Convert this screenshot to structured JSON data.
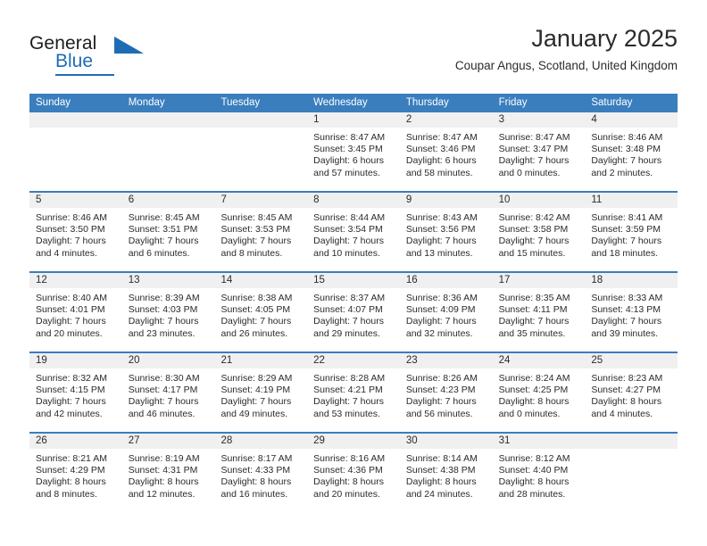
{
  "logo": {
    "general_text": "General",
    "blue_text": "Blue",
    "triangle_color": "#1f6cb4",
    "blue_color": "#1f6cb4",
    "general_color": "#1d1d1d"
  },
  "header": {
    "month_title": "January 2025",
    "location": "Coupar Angus, Scotland, United Kingdom"
  },
  "theme": {
    "header_band": "#3a7ebe",
    "day_band": "#f0f0f0",
    "text": "#2b2b2b"
  },
  "weekdays": [
    "Sunday",
    "Monday",
    "Tuesday",
    "Wednesday",
    "Thursday",
    "Friday",
    "Saturday"
  ],
  "weeks": [
    [
      {
        "day": "",
        "empty": true,
        "lines": []
      },
      {
        "day": "",
        "empty": true,
        "lines": []
      },
      {
        "day": "",
        "empty": true,
        "lines": []
      },
      {
        "day": "1",
        "lines": [
          "Sunrise: 8:47 AM",
          "Sunset: 3:45 PM",
          "Daylight: 6 hours",
          "and 57 minutes."
        ]
      },
      {
        "day": "2",
        "lines": [
          "Sunrise: 8:47 AM",
          "Sunset: 3:46 PM",
          "Daylight: 6 hours",
          "and 58 minutes."
        ]
      },
      {
        "day": "3",
        "lines": [
          "Sunrise: 8:47 AM",
          "Sunset: 3:47 PM",
          "Daylight: 7 hours",
          "and 0 minutes."
        ]
      },
      {
        "day": "4",
        "lines": [
          "Sunrise: 8:46 AM",
          "Sunset: 3:48 PM",
          "Daylight: 7 hours",
          "and 2 minutes."
        ]
      }
    ],
    [
      {
        "day": "5",
        "lines": [
          "Sunrise: 8:46 AM",
          "Sunset: 3:50 PM",
          "Daylight: 7 hours",
          "and 4 minutes."
        ]
      },
      {
        "day": "6",
        "lines": [
          "Sunrise: 8:45 AM",
          "Sunset: 3:51 PM",
          "Daylight: 7 hours",
          "and 6 minutes."
        ]
      },
      {
        "day": "7",
        "lines": [
          "Sunrise: 8:45 AM",
          "Sunset: 3:53 PM",
          "Daylight: 7 hours",
          "and 8 minutes."
        ]
      },
      {
        "day": "8",
        "lines": [
          "Sunrise: 8:44 AM",
          "Sunset: 3:54 PM",
          "Daylight: 7 hours",
          "and 10 minutes."
        ]
      },
      {
        "day": "9",
        "lines": [
          "Sunrise: 8:43 AM",
          "Sunset: 3:56 PM",
          "Daylight: 7 hours",
          "and 13 minutes."
        ]
      },
      {
        "day": "10",
        "lines": [
          "Sunrise: 8:42 AM",
          "Sunset: 3:58 PM",
          "Daylight: 7 hours",
          "and 15 minutes."
        ]
      },
      {
        "day": "11",
        "lines": [
          "Sunrise: 8:41 AM",
          "Sunset: 3:59 PM",
          "Daylight: 7 hours",
          "and 18 minutes."
        ]
      }
    ],
    [
      {
        "day": "12",
        "lines": [
          "Sunrise: 8:40 AM",
          "Sunset: 4:01 PM",
          "Daylight: 7 hours",
          "and 20 minutes."
        ]
      },
      {
        "day": "13",
        "lines": [
          "Sunrise: 8:39 AM",
          "Sunset: 4:03 PM",
          "Daylight: 7 hours",
          "and 23 minutes."
        ]
      },
      {
        "day": "14",
        "lines": [
          "Sunrise: 8:38 AM",
          "Sunset: 4:05 PM",
          "Daylight: 7 hours",
          "and 26 minutes."
        ]
      },
      {
        "day": "15",
        "lines": [
          "Sunrise: 8:37 AM",
          "Sunset: 4:07 PM",
          "Daylight: 7 hours",
          "and 29 minutes."
        ]
      },
      {
        "day": "16",
        "lines": [
          "Sunrise: 8:36 AM",
          "Sunset: 4:09 PM",
          "Daylight: 7 hours",
          "and 32 minutes."
        ]
      },
      {
        "day": "17",
        "lines": [
          "Sunrise: 8:35 AM",
          "Sunset: 4:11 PM",
          "Daylight: 7 hours",
          "and 35 minutes."
        ]
      },
      {
        "day": "18",
        "lines": [
          "Sunrise: 8:33 AM",
          "Sunset: 4:13 PM",
          "Daylight: 7 hours",
          "and 39 minutes."
        ]
      }
    ],
    [
      {
        "day": "19",
        "lines": [
          "Sunrise: 8:32 AM",
          "Sunset: 4:15 PM",
          "Daylight: 7 hours",
          "and 42 minutes."
        ]
      },
      {
        "day": "20",
        "lines": [
          "Sunrise: 8:30 AM",
          "Sunset: 4:17 PM",
          "Daylight: 7 hours",
          "and 46 minutes."
        ]
      },
      {
        "day": "21",
        "lines": [
          "Sunrise: 8:29 AM",
          "Sunset: 4:19 PM",
          "Daylight: 7 hours",
          "and 49 minutes."
        ]
      },
      {
        "day": "22",
        "lines": [
          "Sunrise: 8:28 AM",
          "Sunset: 4:21 PM",
          "Daylight: 7 hours",
          "and 53 minutes."
        ]
      },
      {
        "day": "23",
        "lines": [
          "Sunrise: 8:26 AM",
          "Sunset: 4:23 PM",
          "Daylight: 7 hours",
          "and 56 minutes."
        ]
      },
      {
        "day": "24",
        "lines": [
          "Sunrise: 8:24 AM",
          "Sunset: 4:25 PM",
          "Daylight: 8 hours",
          "and 0 minutes."
        ]
      },
      {
        "day": "25",
        "lines": [
          "Sunrise: 8:23 AM",
          "Sunset: 4:27 PM",
          "Daylight: 8 hours",
          "and 4 minutes."
        ]
      }
    ],
    [
      {
        "day": "26",
        "lines": [
          "Sunrise: 8:21 AM",
          "Sunset: 4:29 PM",
          "Daylight: 8 hours",
          "and 8 minutes."
        ]
      },
      {
        "day": "27",
        "lines": [
          "Sunrise: 8:19 AM",
          "Sunset: 4:31 PM",
          "Daylight: 8 hours",
          "and 12 minutes."
        ]
      },
      {
        "day": "28",
        "lines": [
          "Sunrise: 8:17 AM",
          "Sunset: 4:33 PM",
          "Daylight: 8 hours",
          "and 16 minutes."
        ]
      },
      {
        "day": "29",
        "lines": [
          "Sunrise: 8:16 AM",
          "Sunset: 4:36 PM",
          "Daylight: 8 hours",
          "and 20 minutes."
        ]
      },
      {
        "day": "30",
        "lines": [
          "Sunrise: 8:14 AM",
          "Sunset: 4:38 PM",
          "Daylight: 8 hours",
          "and 24 minutes."
        ]
      },
      {
        "day": "31",
        "lines": [
          "Sunrise: 8:12 AM",
          "Sunset: 4:40 PM",
          "Daylight: 8 hours",
          "and 28 minutes."
        ]
      },
      {
        "day": "",
        "empty": true,
        "lines": []
      }
    ]
  ]
}
